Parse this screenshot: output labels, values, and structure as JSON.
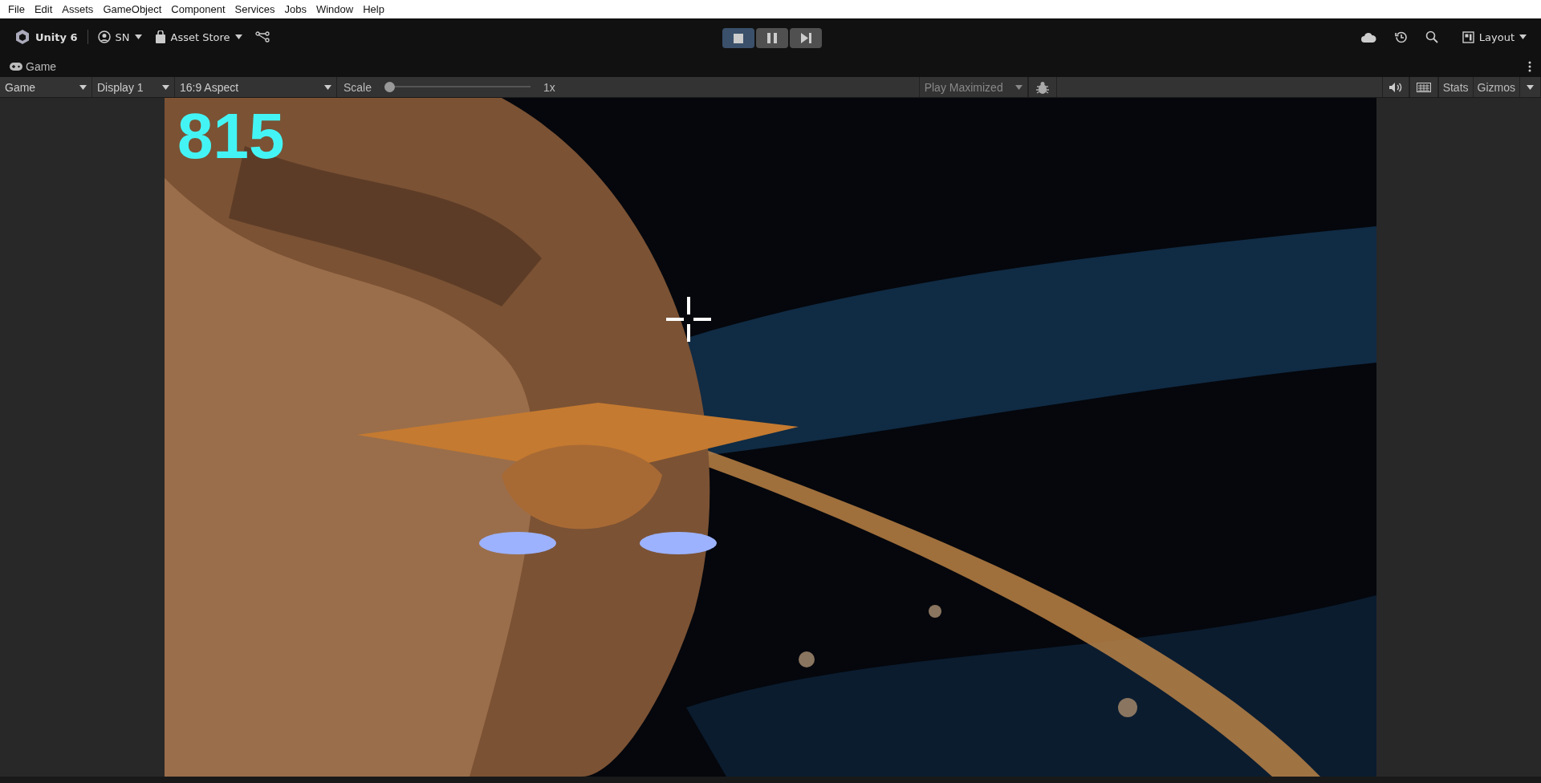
{
  "menu_bar": [
    "File",
    "Edit",
    "Assets",
    "GameObject",
    "Component",
    "Services",
    "Jobs",
    "Window",
    "Help"
  ],
  "toolbar": {
    "product": "Unity 6",
    "account": "SN",
    "asset_store": "Asset Store",
    "play_controls": [
      {
        "kind": "stop",
        "selected": true
      },
      {
        "kind": "pause",
        "selected": false
      },
      {
        "kind": "step",
        "selected": false
      }
    ],
    "layout": "Layout"
  },
  "panel_tab": {
    "label": "Game"
  },
  "game_toolbar": {
    "view": "Game",
    "display": "Display 1",
    "aspect": "16:9 Aspect",
    "scale_label": "Scale",
    "scale": {
      "level": 0
    },
    "scale_reading": "1x",
    "play_mode": "Play Maximized",
    "stats": "Stats",
    "gizmos": "Gizmos"
  },
  "game_view": {
    "kind": "picture",
    "score": "815"
  }
}
